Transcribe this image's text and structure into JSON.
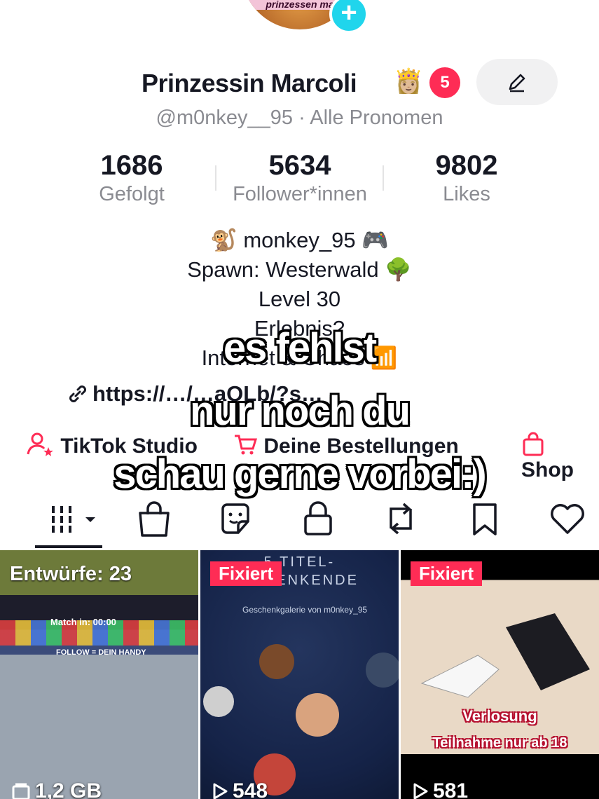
{
  "profile": {
    "avatar_banner": "prinzessen ma",
    "name": "Prinzessin Marcoli",
    "name_emoji": "👸🏼",
    "notification_count": "5",
    "handle": "@m0nkey__95",
    "pronouns": "Alle Pronomen",
    "handle_separator": "·"
  },
  "stats": [
    {
      "value": "1686",
      "label": "Gefolgt"
    },
    {
      "value": "5634",
      "label": "Follower*innen"
    },
    {
      "value": "9802",
      "label": "Likes"
    }
  ],
  "bio": {
    "line1": "🐒 monkey_95 🎮",
    "line2": "Spawn: Westerwald 🌳",
    "line3": "Level 30",
    "line4": "Erlebnis?",
    "line5": "Internet & Chaos 📶",
    "link": "https://…/…aQLb/?s…"
  },
  "shortcuts": {
    "tiktok": "TikTok Studio",
    "orders": "Deine Bestellungen",
    "shop": "Shop"
  },
  "caption": {
    "line1": "es fehlst",
    "line2": "nur noch du",
    "line3": "schau gerne vorbei:)"
  },
  "tabs": [
    "videos-icon",
    "shop-bag-icon",
    "sticker-icon",
    "lock-icon",
    "repost-icon",
    "bookmark-icon",
    "heart-icon"
  ],
  "grid": [
    {
      "label": "Entwürfe: 23",
      "size": "1,2 GB",
      "hud_match": "Match in: 00:00",
      "hud_follow": "FOLLOW = DEIN HANDY"
    },
    {
      "pill": "Fixiert",
      "title": "5 TITEL-\nSCHENKENDE",
      "subtitle": "Geschenkgalerie von m0nkey_95",
      "views": "548"
    },
    {
      "pill": "Fixiert",
      "overlay1": "Verlosung",
      "overlay2": "Teilnahme nur ab 18",
      "views": "581"
    }
  ],
  "colors": {
    "accent": "#fe2c55",
    "cyan": "#20d5ec",
    "text": "#161823",
    "muted": "#8a8b91"
  }
}
